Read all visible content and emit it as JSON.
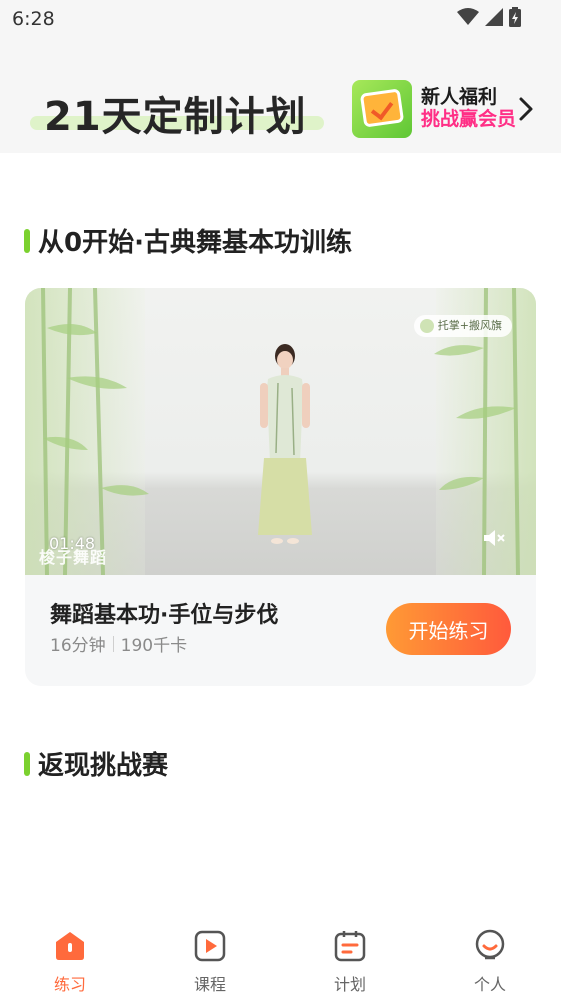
{
  "status_bar": {
    "time": "6:28"
  },
  "header": {
    "title": "21天定制计划",
    "promo": {
      "line1": "新人福利",
      "line2": "挑战赢会员"
    }
  },
  "section1": {
    "title": "从0开始·古典舞基本功训练"
  },
  "card": {
    "video": {
      "watermark_tag": "托掌+搬风旗",
      "time": "01:48",
      "logo_text": "梭子舞蹈"
    },
    "lesson_title": "舞蹈基本功·手位与步伐",
    "duration": "16分钟",
    "calories": "190千卡",
    "start_label": "开始练习"
  },
  "section2": {
    "title": "返现挑战赛"
  },
  "tabbar": {
    "tabs": [
      {
        "label": "练习",
        "icon": "practice-icon",
        "active": true
      },
      {
        "label": "课程",
        "icon": "course-icon",
        "active": false
      },
      {
        "label": "计划",
        "icon": "plan-icon",
        "active": false
      },
      {
        "label": "个人",
        "icon": "profile-icon",
        "active": false
      }
    ]
  },
  "colors": {
    "accent_orange": "#ff6a3c",
    "accent_green": "#7bd12f",
    "promo_pink": "#ff2f86"
  }
}
